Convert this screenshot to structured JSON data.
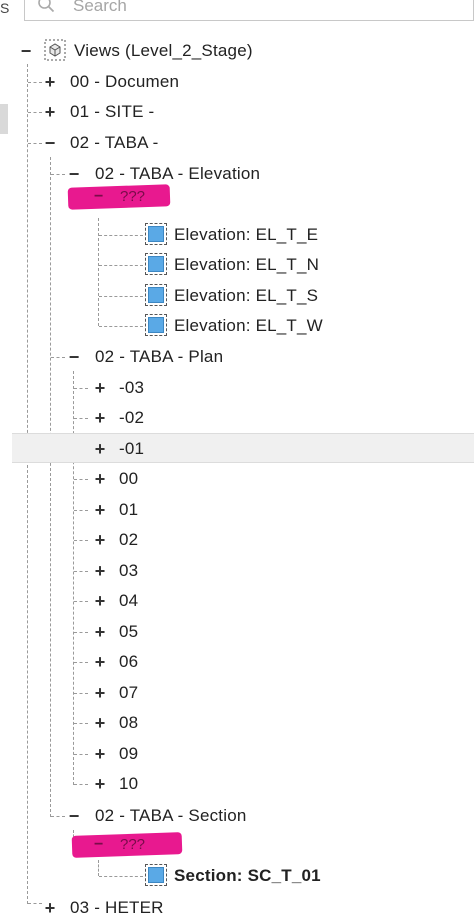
{
  "left_strip": {
    "top_char": "S"
  },
  "search": {
    "placeholder": "Search"
  },
  "root": {
    "label": "Views (Level_2_Stage)",
    "toggle": "−"
  },
  "groups": [
    {
      "label": "00 - Documen",
      "toggle": "+"
    },
    {
      "label": "01 - SITE -",
      "toggle": "+"
    },
    {
      "label": "02 - TABA -",
      "toggle": "−"
    }
  ],
  "elevation": {
    "label": "02 - TABA - Elevation",
    "toggle": "−",
    "hidden_label": "???",
    "hidden_toggle": "−",
    "views": [
      "Elevation: EL_T_E",
      "Elevation: EL_T_N",
      "Elevation: EL_T_S",
      "Elevation: EL_T_W"
    ]
  },
  "plan": {
    "label": "02 - TABA - Plan",
    "toggle": "−",
    "items": [
      "-03",
      "-02",
      "-01",
      "00",
      "01",
      "02",
      "03",
      "04",
      "05",
      "06",
      "07",
      "08",
      "09",
      "10"
    ],
    "item_toggle": "+",
    "selected_item": "-01"
  },
  "section": {
    "label": "02 - TABA - Section",
    "toggle": "−",
    "hidden_label": "???",
    "hidden_toggle": "−",
    "views": [
      "Section: SC_T_01"
    ]
  },
  "last_group": {
    "label": "03 - HETER",
    "toggle": "+"
  },
  "colors": {
    "view_icon_fill": "#5aa9e6",
    "redaction_mark": "#e8198f",
    "selection_bg": "#f0f0f0"
  }
}
